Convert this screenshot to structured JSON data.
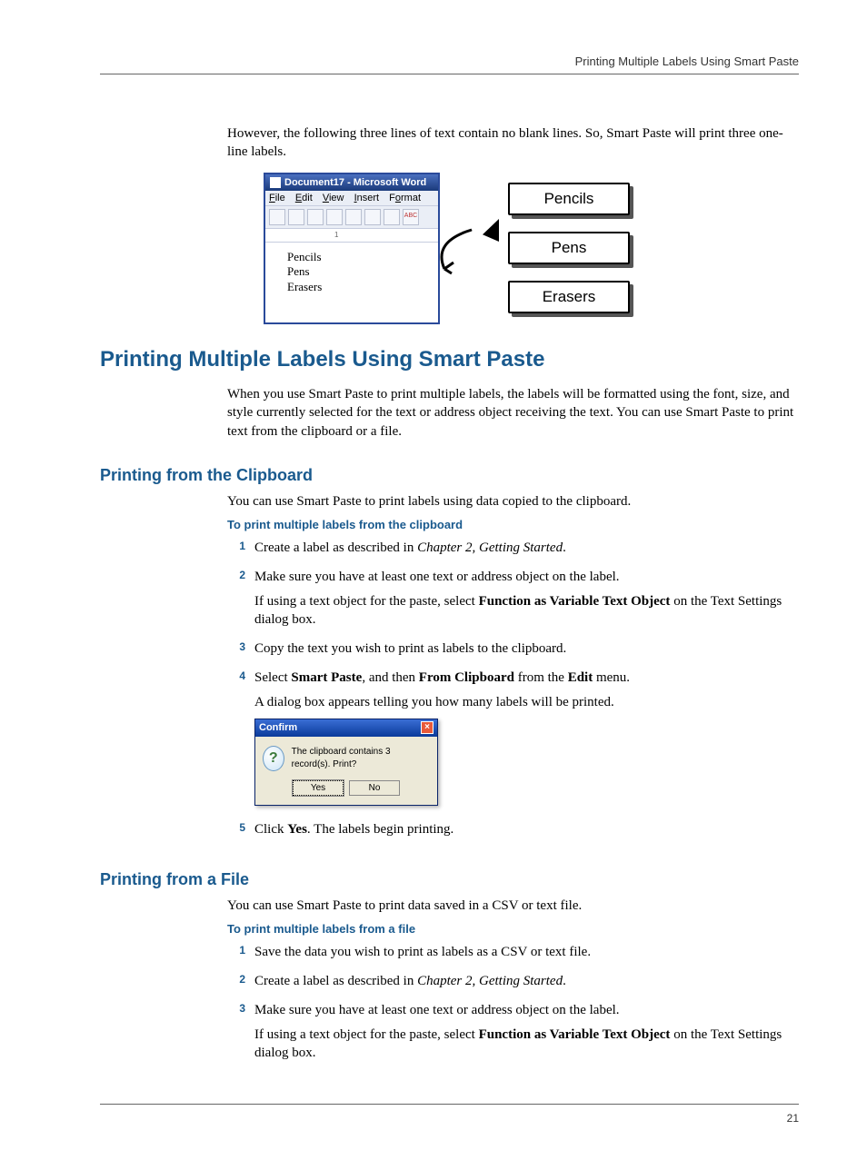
{
  "header": {
    "running": "Printing Multiple Labels Using Smart Paste"
  },
  "intro": "However, the following three lines of text contain no blank lines. So, Smart Paste will print three one-line labels.",
  "word_window": {
    "title": "Document17 - Microsoft Word",
    "menus": {
      "file": "File",
      "edit": "Edit",
      "view": "View",
      "insert": "Insert",
      "format": "Format"
    },
    "body_lines": [
      "Pencils",
      "Pens",
      "Erasers"
    ]
  },
  "labels": {
    "pencils": "Pencils",
    "pens": "Pens",
    "erasers": "Erasers"
  },
  "section1": {
    "title": "Printing Multiple Labels Using Smart Paste",
    "body": "When you use Smart Paste to print multiple labels, the labels will be formatted using the font, size, and style currently selected for the text or address object receiving the text. You can use Smart Paste to print text from the clipboard or a file."
  },
  "clipboard": {
    "title": "Printing from the Clipboard",
    "intro": "You can use Smart Paste to print labels using data copied to the clipboard.",
    "proc_title": "To print multiple labels from the clipboard",
    "steps": {
      "s1_pre": "Create a label as described in ",
      "s1_ital": "Chapter 2, Getting Started",
      "s1_post": ".",
      "s2": "Make sure you have at least one text or address object on the label.",
      "s2_note_pre": "If using a text object for the paste, select ",
      "s2_note_bold": "Function as Variable Text Object",
      "s2_note_post": " on the Text Settings dialog box.",
      "s3": "Copy the text you wish to print as labels to the clipboard.",
      "s4_pre": "Select ",
      "s4_b1": "Smart Paste",
      "s4_mid1": ", and then ",
      "s4_b2": "From Clipboard",
      "s4_mid2": " from the ",
      "s4_b3": "Edit",
      "s4_post": " menu.",
      "s4_line2": "A dialog box appears telling you how many labels will be printed.",
      "s5_pre": "Click ",
      "s5_b": "Yes",
      "s5_post": ". The labels begin printing."
    }
  },
  "confirm": {
    "title": "Confirm",
    "message": "The clipboard contains 3 record(s). Print?",
    "yes": "Yes",
    "no": "No"
  },
  "file": {
    "title": "Printing from a File",
    "intro": "You can use Smart Paste to print data saved in a CSV or text file.",
    "proc_title": "To print multiple labels from a file",
    "steps": {
      "s1": "Save the data you wish to print as labels as a CSV or text file.",
      "s2_pre": "Create a label as described in ",
      "s2_ital": "Chapter 2, Getting Started",
      "s2_post": ".",
      "s3": "Make sure you have at least one text or address object on the label.",
      "s3_note_pre": "If using a text object for the paste, select ",
      "s3_note_bold": "Function as Variable Text Object",
      "s3_note_post": " on the Text Settings dialog box."
    }
  },
  "page_num": "21"
}
